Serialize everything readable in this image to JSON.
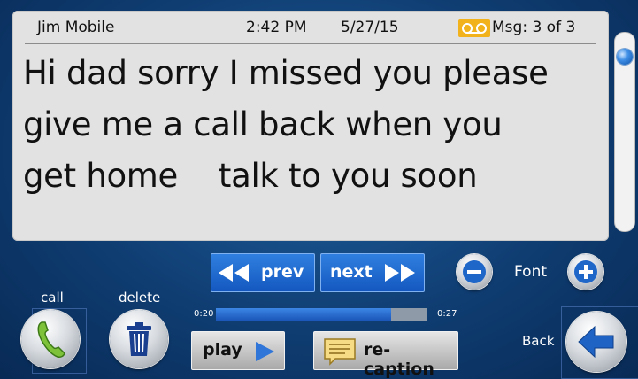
{
  "header": {
    "caller": "Jim Mobile",
    "time": "2:42  PM",
    "date": "5/27/15",
    "msg": "Msg:   3 of 3"
  },
  "message": {
    "lines": [
      "Hi dad sorry I missed you please",
      "give me a call back when you",
      "get home    talk to you soon"
    ]
  },
  "nav": {
    "prev_label": "prev",
    "next_label": "next",
    "font_label": "Font"
  },
  "actions": {
    "call_label": "call",
    "delete_label": "delete",
    "back_label": "Back",
    "play_label": "play",
    "recaption_label": "re-caption"
  },
  "playback": {
    "start": "0:20",
    "end": "0:27",
    "progress": 0.83
  },
  "icons": [
    "voicemail-icon",
    "rewind-icon",
    "fast-forward-icon",
    "minus-icon",
    "plus-icon",
    "phone-icon",
    "trash-icon",
    "play-icon",
    "caption-icon",
    "back-arrow-icon"
  ],
  "colors": {
    "accent": "#1f6bd6",
    "voicemail": "#f1b21b"
  }
}
